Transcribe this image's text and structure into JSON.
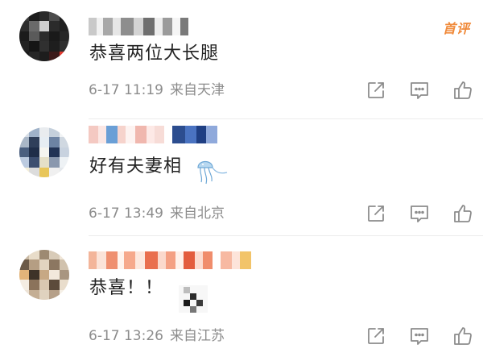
{
  "comments": [
    {
      "text": "恭喜两位大长腿",
      "time": "6-17 11:19",
      "location": "来自天津",
      "badge": "首评"
    },
    {
      "text": "好有夫妻相",
      "time": "6-17 13:49",
      "location": "来自北京"
    },
    {
      "text": "恭喜！！",
      "time": "6-17 13:26",
      "location": "来自江苏"
    }
  ],
  "icons": {
    "share": "share-icon",
    "comment": "comment-icon",
    "like": "thumbs-up-icon"
  },
  "colors": {
    "badge": "#f08a3a",
    "meta": "#8c8c8c",
    "text": "#222222"
  }
}
